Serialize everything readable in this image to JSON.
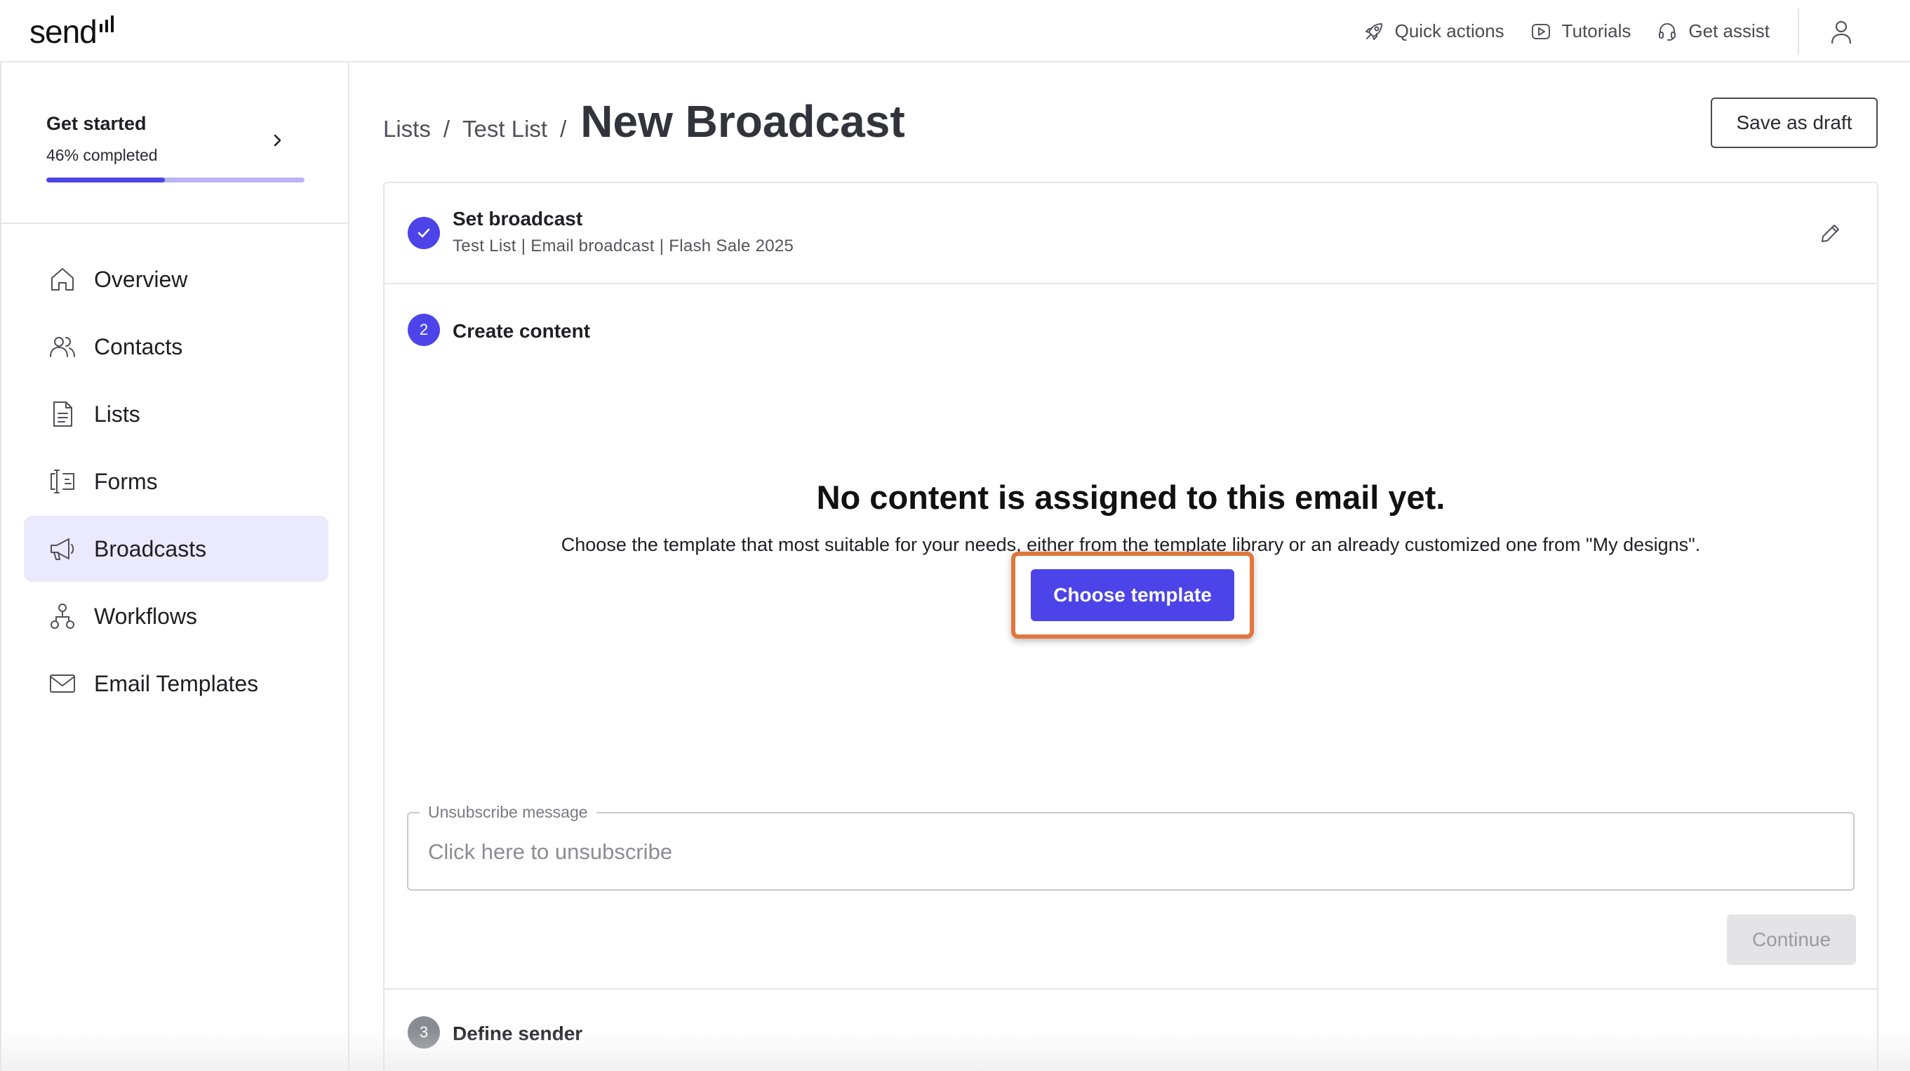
{
  "header": {
    "logo_text": "send",
    "actions": [
      {
        "label": "Quick actions",
        "icon": "rocket-icon"
      },
      {
        "label": "Tutorials",
        "icon": "play-icon"
      },
      {
        "label": "Get assist",
        "icon": "headset-icon"
      }
    ],
    "avatar_icon": "user-icon"
  },
  "sidebar": {
    "get_started": {
      "title": "Get started",
      "progress_text": "46% completed",
      "progress": 0.46
    },
    "items": [
      {
        "label": "Overview",
        "icon": "home-icon"
      },
      {
        "label": "Contacts",
        "icon": "contacts-icon"
      },
      {
        "label": "Lists",
        "icon": "list-icon"
      },
      {
        "label": "Forms",
        "icon": "form-icon"
      },
      {
        "label": "Broadcasts",
        "icon": "megaphone-icon",
        "active": true
      },
      {
        "label": "Workflows",
        "icon": "workflow-icon"
      },
      {
        "label": "Email Templates",
        "icon": "mail-icon"
      }
    ]
  },
  "breadcrumb": {
    "items": [
      "Lists",
      "Test List"
    ],
    "separator": "/",
    "current": "New Broadcast"
  },
  "toolbar": {
    "save_draft_label": "Save as draft"
  },
  "steps": {
    "step1": {
      "title": "Set broadcast",
      "summary": "Test List | Email broadcast | Flash Sale 2025",
      "completed": true
    },
    "step2": {
      "number": "2",
      "title": "Create content",
      "empty_title": "No content is assigned to this email yet.",
      "empty_description": "Choose the template that most suitable for your needs, either from the template library or an already customized one from \"My designs\".",
      "choose_label": "Choose template",
      "unsubscribe": {
        "label": "Unsubscribe message",
        "placeholder": "Click here to unsubscribe",
        "value": ""
      },
      "continue_label": "Continue"
    },
    "step3": {
      "number": "3",
      "title": "Define sender"
    }
  },
  "colors": {
    "accent": "#4c44e8",
    "accent_light": "#ebe9fd",
    "progress_track": "#b9b4f4",
    "highlight": "#e0773e",
    "disabled_bg": "#e4e4e6",
    "step_inactive": "#8a8a92"
  }
}
